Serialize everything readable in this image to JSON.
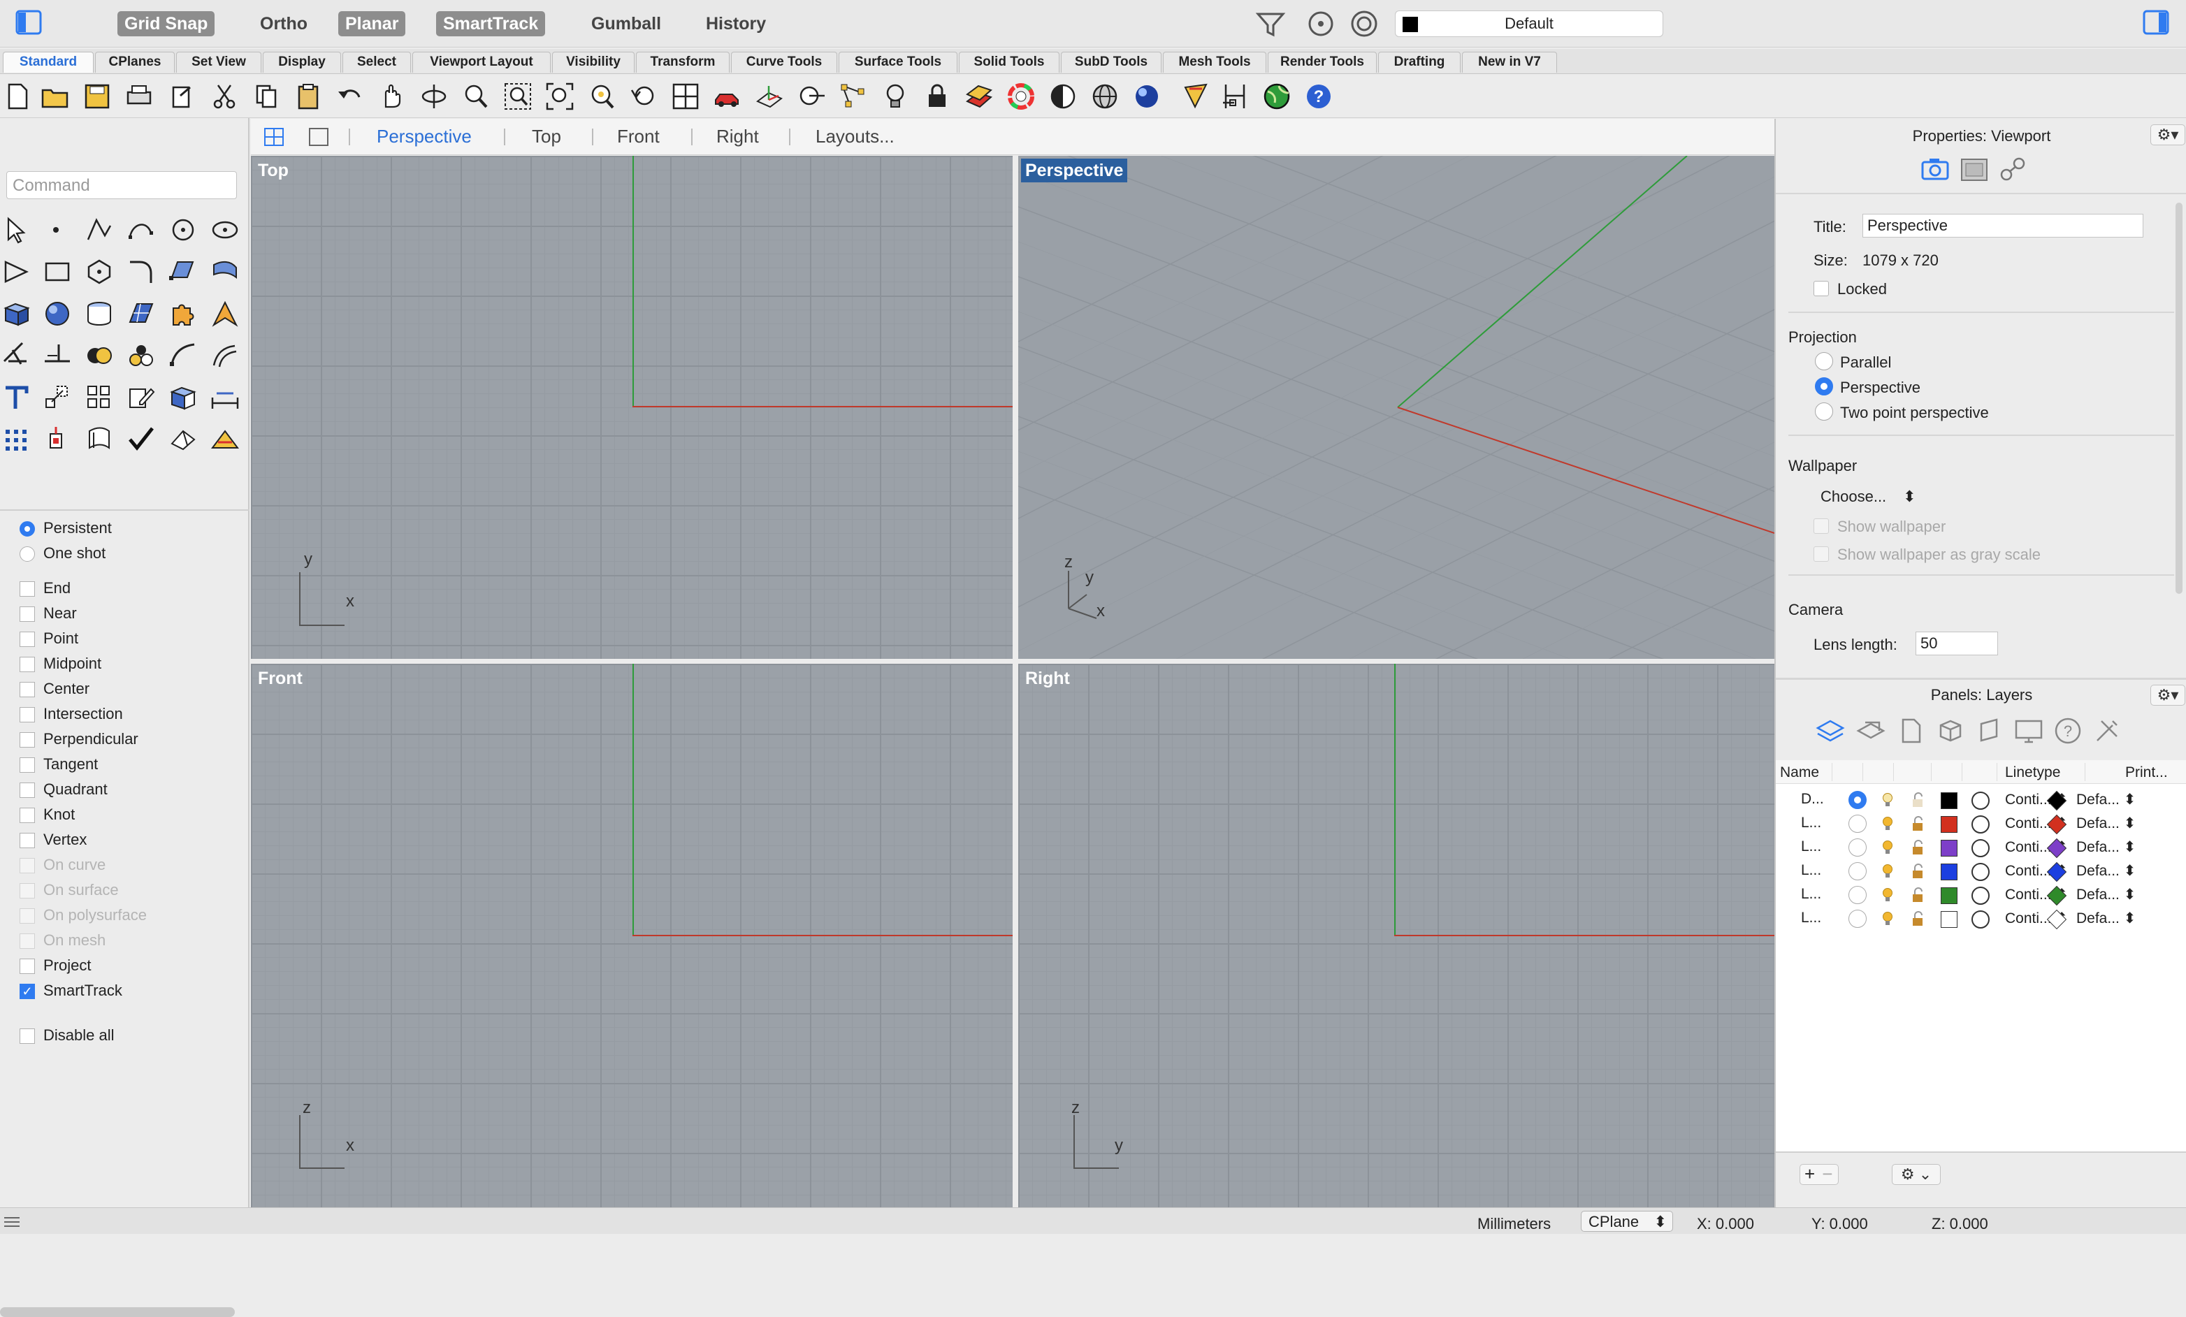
{
  "topbar": {
    "toggles": [
      "Grid Snap",
      "Ortho",
      "Planar",
      "SmartTrack",
      "Gumball",
      "History"
    ],
    "layer_name": "Default"
  },
  "tabs": [
    "Standard",
    "CPlanes",
    "Set View",
    "Display",
    "Select",
    "Viewport Layout",
    "Visibility",
    "Transform",
    "Curve Tools",
    "Surface Tools",
    "Solid Tools",
    "SubD Tools",
    "Mesh Tools",
    "Render Tools",
    "Drafting",
    "New in V7"
  ],
  "command": {
    "placeholder": "Command"
  },
  "viewport_tabs": [
    "Perspective",
    "Top",
    "Front",
    "Right",
    "Layouts..."
  ],
  "viewports": {
    "top": {
      "label": "Top",
      "axis_v": "y",
      "axis_h": "x"
    },
    "perspective": {
      "label": "Perspective",
      "axis_z": "z",
      "axis_y": "y",
      "axis_x": "x"
    },
    "front": {
      "label": "Front",
      "axis_v": "z",
      "axis_h": "x"
    },
    "right": {
      "label": "Right",
      "axis_v": "z",
      "axis_h": "y"
    }
  },
  "osnap": {
    "mode": [
      "Persistent",
      "One shot"
    ],
    "items": [
      {
        "label": "End",
        "checked": false,
        "disabled": false
      },
      {
        "label": "Near",
        "checked": false,
        "disabled": false
      },
      {
        "label": "Point",
        "checked": false,
        "disabled": false
      },
      {
        "label": "Midpoint",
        "checked": false,
        "disabled": false
      },
      {
        "label": "Center",
        "checked": false,
        "disabled": false
      },
      {
        "label": "Intersection",
        "checked": false,
        "disabled": false
      },
      {
        "label": "Perpendicular",
        "checked": false,
        "disabled": false
      },
      {
        "label": "Tangent",
        "checked": false,
        "disabled": false
      },
      {
        "label": "Quadrant",
        "checked": false,
        "disabled": false
      },
      {
        "label": "Knot",
        "checked": false,
        "disabled": false
      },
      {
        "label": "Vertex",
        "checked": false,
        "disabled": false
      },
      {
        "label": "On curve",
        "checked": false,
        "disabled": true
      },
      {
        "label": "On surface",
        "checked": false,
        "disabled": true
      },
      {
        "label": "On polysurface",
        "checked": false,
        "disabled": true
      },
      {
        "label": "On mesh",
        "checked": false,
        "disabled": true
      },
      {
        "label": "Project",
        "checked": false,
        "disabled": false
      },
      {
        "label": "SmartTrack",
        "checked": true,
        "disabled": false
      }
    ],
    "disable_all": "Disable all"
  },
  "properties": {
    "title": "Properties: Viewport",
    "title_label": "Title:",
    "title_value": "Perspective",
    "size_label": "Size:",
    "size_value": "1079 x 720",
    "locked": "Locked",
    "projection": "Projection",
    "proj_parallel": "Parallel",
    "proj_perspective": "Perspective",
    "proj_two_point": "Two point perspective",
    "wallpaper": "Wallpaper",
    "choose": "Choose...",
    "show_wallpaper": "Show wallpaper",
    "show_gray": "Show wallpaper as gray scale",
    "camera": "Camera",
    "lens_label": "Lens length:",
    "lens_value": "50"
  },
  "layers_panel": {
    "title": "Panels: Layers",
    "col_name": "Name",
    "col_linetype": "Linetype",
    "col_print": "Print...",
    "rows": [
      {
        "name": "D...",
        "current": true,
        "color": "#000000",
        "linetype": "Conti...",
        "print": "Defa..."
      },
      {
        "name": "L...",
        "current": false,
        "color": "#d2301f",
        "linetype": "Conti...",
        "print": "Defa..."
      },
      {
        "name": "L...",
        "current": false,
        "color": "#7d3fc8",
        "linetype": "Conti...",
        "print": "Defa..."
      },
      {
        "name": "L...",
        "current": false,
        "color": "#1c3fe0",
        "linetype": "Conti...",
        "print": "Defa..."
      },
      {
        "name": "L...",
        "current": false,
        "color": "#2f8a2a",
        "linetype": "Conti...",
        "print": "Defa..."
      },
      {
        "name": "L...",
        "current": false,
        "color": "#ffffff",
        "linetype": "Conti...",
        "print": "Defa..."
      }
    ]
  },
  "status": {
    "units": "Millimeters",
    "cplane": "CPlane",
    "x": "X: 0.000",
    "y": "Y: 0.000",
    "z": "Z: 0.000"
  },
  "colors": {
    "accent": "#2f7bf0",
    "active_viewport": "#2b5f9e",
    "x_axis": "#c0392b",
    "y_axis": "#2e9c3a"
  }
}
